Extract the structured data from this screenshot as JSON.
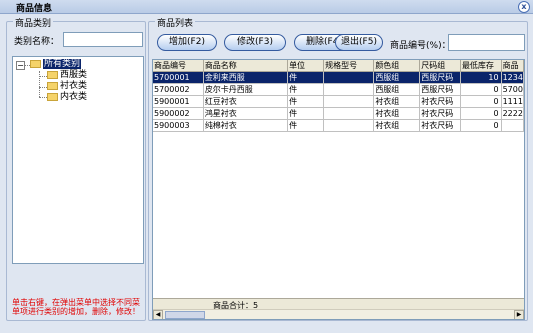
{
  "window": {
    "title": "商品信息",
    "close_glyph": "x"
  },
  "category_panel": {
    "legend": "商品类别",
    "name_label": "类别名称：",
    "name_value": "",
    "tree": {
      "root": "所有类别",
      "children": [
        "西服类",
        "衬衣类",
        "内衣类"
      ]
    },
    "hint": "单击右键，在弹出菜单中选择不同菜单项进行类别的增加，删除，修改！"
  },
  "list_panel": {
    "legend": "商品列表",
    "buttons": {
      "add": "增加(F2)",
      "edit": "修改(F3)",
      "delete": "删除(F4)",
      "exit": "退出(F5)"
    },
    "code_label": "商品编号(%)：",
    "code_value": "",
    "columns": [
      "商品编号",
      "商品名称",
      "单位",
      "规格型号",
      "颜色组",
      "尺码组",
      "最低库存",
      "商品"
    ],
    "rows": [
      {
        "code": "5700001",
        "name": "金利来西服",
        "unit": "件",
        "spec": "",
        "color": "西服组",
        "size": "西服尺码",
        "min_stock": "10",
        "extra": "1234",
        "selected": true
      },
      {
        "code": "5700002",
        "name": "皮尔卡丹西服",
        "unit": "件",
        "spec": "",
        "color": "西服组",
        "size": "西服尺码",
        "min_stock": "0",
        "extra": "5700",
        "selected": false
      },
      {
        "code": "5900001",
        "name": "红豆衬衣",
        "unit": "件",
        "spec": "",
        "color": "衬衣组",
        "size": "衬衣尺码",
        "min_stock": "0",
        "extra": "1111",
        "selected": false
      },
      {
        "code": "5900002",
        "name": "鸿星衬衣",
        "unit": "件",
        "spec": "",
        "color": "衬衣组",
        "size": "衬衣尺码",
        "min_stock": "0",
        "extra": "2222",
        "selected": false
      },
      {
        "code": "5900003",
        "name": "纯棉衬衣",
        "unit": "件",
        "spec": "",
        "color": "衬衣组",
        "size": "衬衣尺码",
        "min_stock": "0",
        "extra": "",
        "selected": false
      }
    ],
    "summary": "商品合计：5"
  }
}
